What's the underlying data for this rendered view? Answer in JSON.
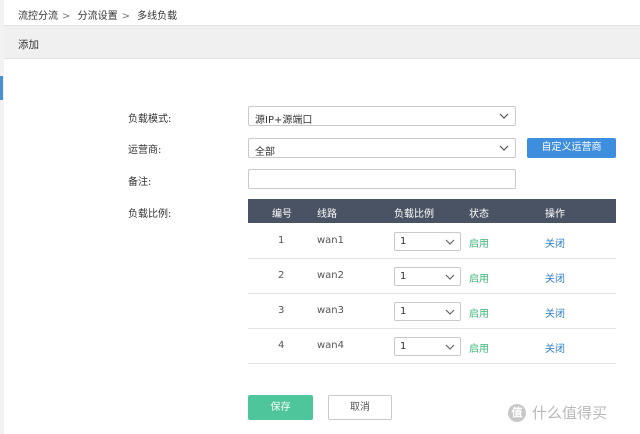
{
  "breadcrumb": [
    "流控分流",
    "分流设置",
    "多线负载"
  ],
  "breadcrumb_separator": ">",
  "header": {
    "title": "添加"
  },
  "form": {
    "load_mode": {
      "label": "负载模式:",
      "value": "源IP+源端口"
    },
    "isp": {
      "label": "运营商:",
      "value": "全部",
      "custom_button": "自定义运营商"
    },
    "remark": {
      "label": "备注:",
      "value": ""
    },
    "ratio": {
      "label": "负载比例:"
    }
  },
  "table": {
    "headers": [
      "编号",
      "线路",
      "负载比例",
      "状态",
      "操作"
    ],
    "rows": [
      {
        "num": "1",
        "line": "wan1",
        "ratio": "1",
        "status": "启用",
        "action": "关闭"
      },
      {
        "num": "2",
        "line": "wan2",
        "ratio": "1",
        "status": "启用",
        "action": "关闭"
      },
      {
        "num": "3",
        "line": "wan3",
        "ratio": "1",
        "status": "启用",
        "action": "关闭"
      },
      {
        "num": "4",
        "line": "wan4",
        "ratio": "1",
        "status": "启用",
        "action": "关闭"
      }
    ]
  },
  "buttons": {
    "save": "保存",
    "cancel": "取消"
  },
  "watermark": {
    "badge": "值",
    "text": "什么值得买"
  },
  "colors": {
    "accent": "#3e8ee0",
    "save": "#4ec59a",
    "status_enabled": "#3cb878",
    "link": "#2f7fd0",
    "table_header": "#4a5363"
  }
}
